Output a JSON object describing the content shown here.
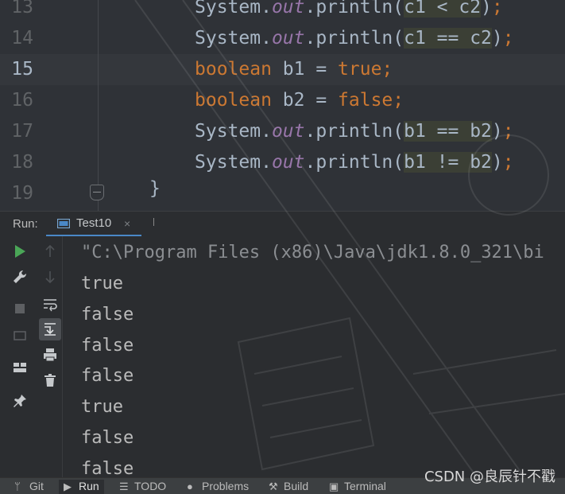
{
  "editor": {
    "lines": [
      {
        "num": "13",
        "parts": [
          [
            "plain",
            "System."
          ],
          [
            "fld",
            "out"
          ],
          [
            "plain",
            ".println("
          ],
          [
            "hl",
            "c1 < c2"
          ],
          [
            "plain",
            ")"
          ],
          [
            "kw",
            ";"
          ]
        ]
      },
      {
        "num": "14",
        "parts": [
          [
            "plain",
            "System."
          ],
          [
            "fld",
            "out"
          ],
          [
            "plain",
            ".println("
          ],
          [
            "hl",
            "c1 == c2"
          ],
          [
            "plain",
            ")"
          ],
          [
            "kw",
            ";"
          ]
        ]
      },
      {
        "num": "15",
        "parts": [
          [
            "kw",
            "boolean "
          ],
          [
            "plain",
            "b1 = "
          ],
          [
            "kw",
            "true;"
          ]
        ]
      },
      {
        "num": "16",
        "parts": [
          [
            "kw",
            "boolean "
          ],
          [
            "plain",
            "b2 = "
          ],
          [
            "kw",
            "false;"
          ]
        ]
      },
      {
        "num": "17",
        "parts": [
          [
            "plain",
            "System."
          ],
          [
            "fld",
            "out"
          ],
          [
            "plain",
            ".println("
          ],
          [
            "hl",
            "b1 == b2"
          ],
          [
            "plain",
            ")"
          ],
          [
            "kw",
            ";"
          ]
        ]
      },
      {
        "num": "18",
        "parts": [
          [
            "plain",
            "System."
          ],
          [
            "fld",
            "out"
          ],
          [
            "plain",
            ".println("
          ],
          [
            "hl",
            "b1 != b2"
          ],
          [
            "plain",
            ")"
          ],
          [
            "kw",
            ";"
          ]
        ]
      },
      {
        "num": "19",
        "parts": []
      }
    ],
    "closing_brace": "}",
    "current_line": "15"
  },
  "run_panel": {
    "label": "Run:",
    "tab_title": "Test10",
    "tab_close": "×"
  },
  "console": {
    "command": "\"C:\\Program Files (x86)\\Java\\jdk1.8.0_321\\bi",
    "output": [
      "true",
      "false",
      "false",
      "false",
      "true",
      "false",
      "false"
    ]
  },
  "statusbar": {
    "git": "Git",
    "run": "Run",
    "todo": "TODO",
    "problems": "Problems",
    "build": "Build",
    "terminal": "Terminal"
  },
  "watermark_text": "CSDN @良辰针不戳",
  "colors": {
    "keyword": "#cc7832",
    "field": "#9876aa",
    "text": "#a9b7c6",
    "run_green": "#4aa657",
    "tab_underline": "#4a88c7"
  }
}
